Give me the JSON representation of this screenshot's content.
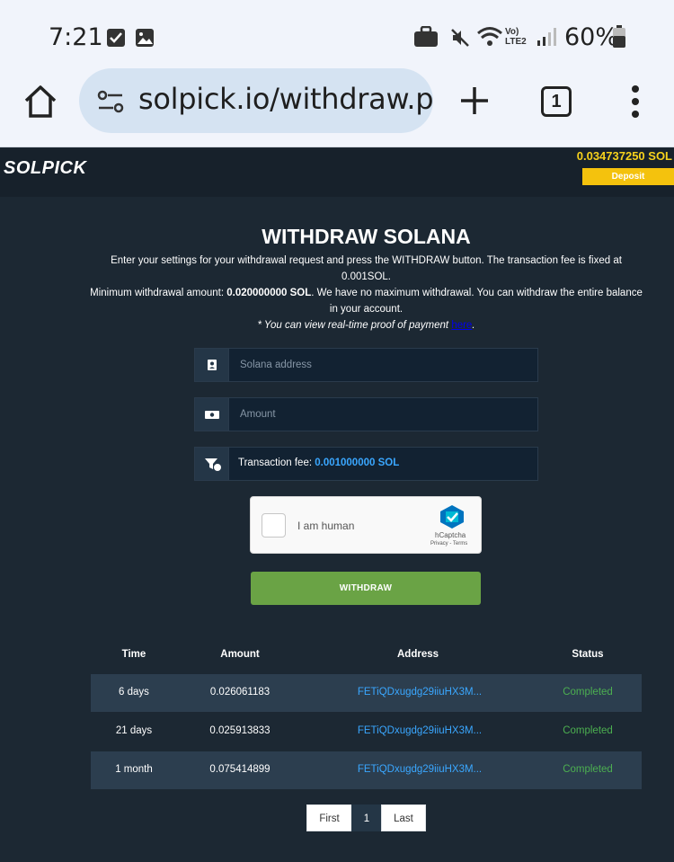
{
  "status_bar": {
    "time": "7:21",
    "battery_pct": "60%",
    "network_label": "Vo) LTE2",
    "icons": [
      "checkbox-notification-icon",
      "image-notification-icon",
      "briefcase-icon",
      "mute-icon",
      "wifi-icon",
      "signal-icon",
      "battery-icon"
    ]
  },
  "browser": {
    "url": "solpick.io/withdraw.php",
    "tab_count": "1"
  },
  "site": {
    "logo": "SOLPICK",
    "balance": "0.034737250 SOL",
    "deposit_label": "Deposit"
  },
  "page": {
    "title": "WITHDRAW SOLANA",
    "intro_line1": "Enter your settings for your withdrawal request and press the WITHDRAW button. The transaction fee is fixed at 0.001SOL.",
    "min_label": "Minimum withdrawal amount: ",
    "min_value": "0.020000000 SOL",
    "intro_line2": ". We have no maximum withdrawal. You can withdraw the entire balance in your account.",
    "proof_text": "* You can view real-time proof of payment ",
    "proof_link": "here",
    "proof_end": "."
  },
  "form": {
    "address_placeholder": "Solana address",
    "amount_placeholder": "Amount",
    "fee_label": "Transaction fee: ",
    "fee_value": "0.001000000 SOL",
    "captcha_label": "I am human",
    "captcha_brand": "hCaptcha",
    "captcha_terms": "Privacy - Terms",
    "withdraw_label": "WITHDRAW"
  },
  "history": {
    "headers": [
      "Time",
      "Amount",
      "Address",
      "Status"
    ],
    "rows": [
      {
        "time": "6 days",
        "amount": "0.026061183",
        "address": "FETiQDxugdg29iiuHX3M...",
        "status": "Completed"
      },
      {
        "time": "21 days",
        "amount": "0.025913833",
        "address": "FETiQDxugdg29iiuHX3M...",
        "status": "Completed"
      },
      {
        "time": "1 month",
        "amount": "0.075414899",
        "address": "FETiQDxugdg29iiuHX3M...",
        "status": "Completed"
      }
    ]
  },
  "pagination": {
    "first": "First",
    "current": "1",
    "last": "Last"
  },
  "colors": {
    "page_bg": "#1c2833",
    "accent_blue": "#3aa7ff",
    "balance_yellow": "#f7d21c",
    "deposit_yellow": "#f4c20d",
    "withdraw_green": "#6aa345",
    "completed_green": "#4caf50"
  }
}
